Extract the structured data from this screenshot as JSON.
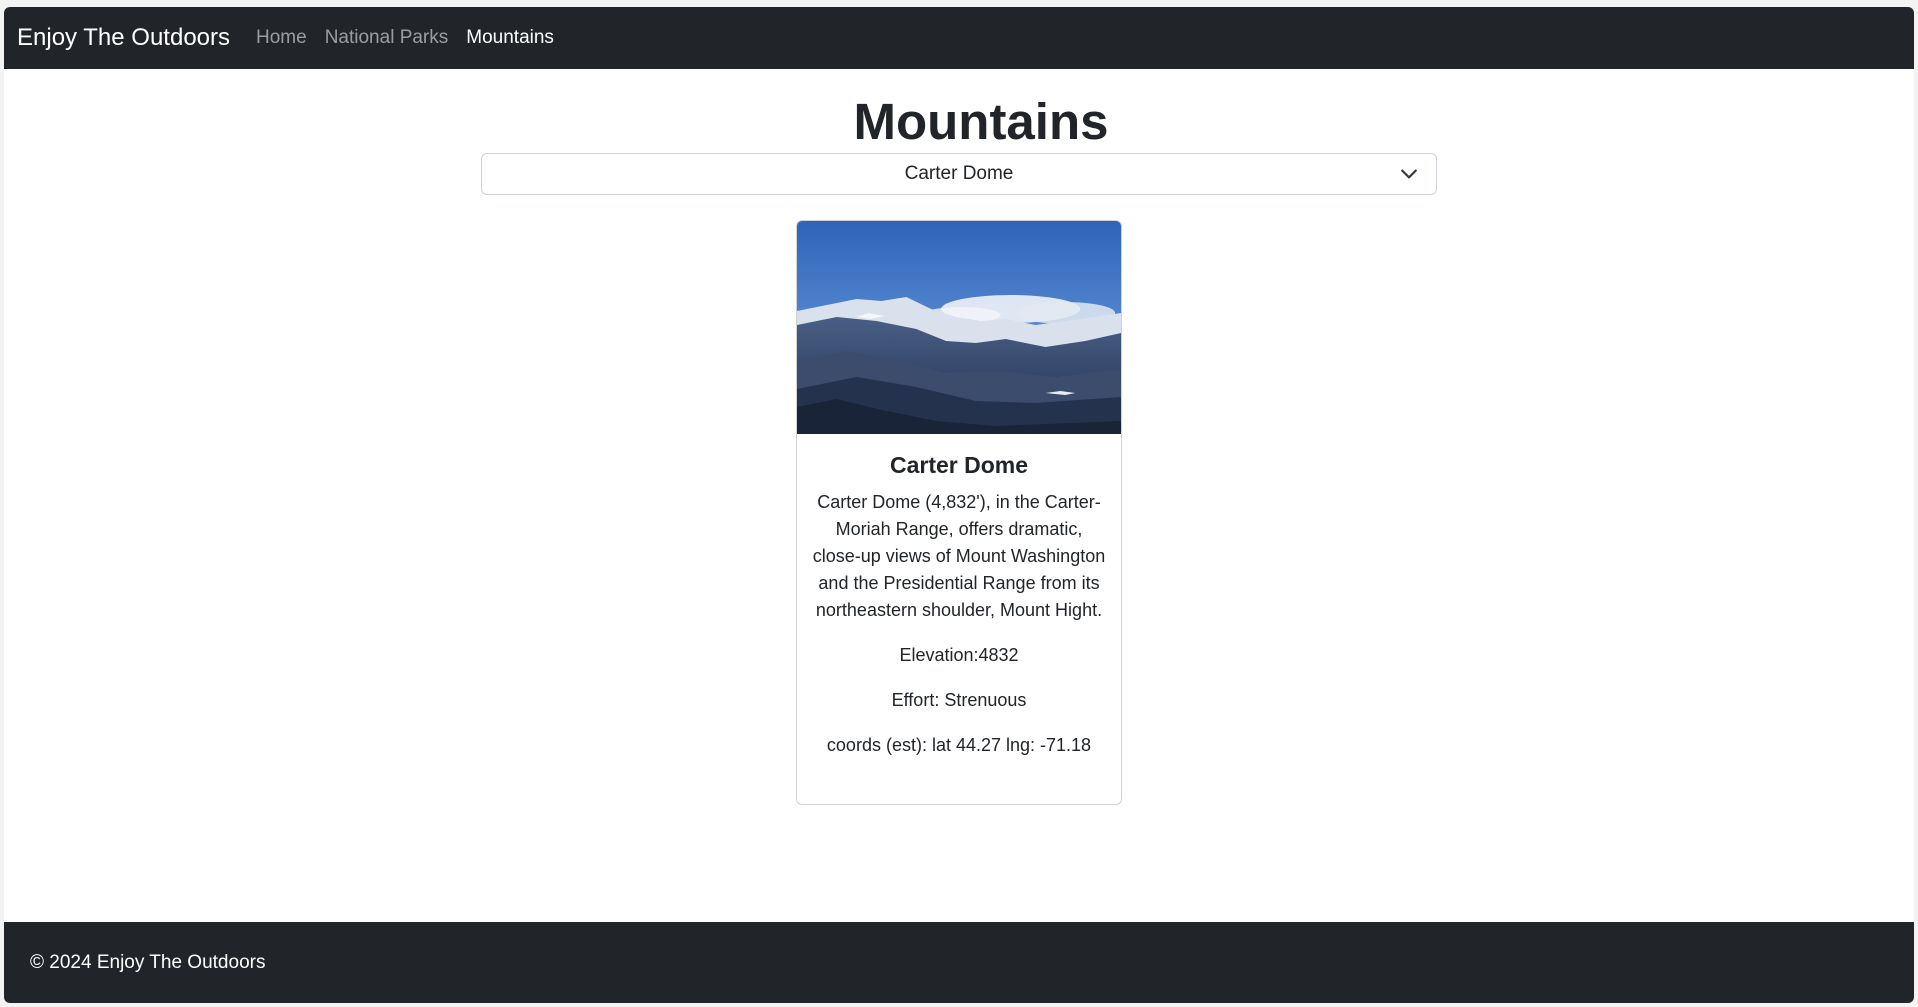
{
  "navbar": {
    "brand": "Enjoy The Outdoors",
    "links": [
      {
        "label": "Home",
        "active": false
      },
      {
        "label": "National Parks",
        "active": false
      },
      {
        "label": "Mountains",
        "active": true
      }
    ]
  },
  "main": {
    "title": "Mountains",
    "select": {
      "value": "Carter Dome",
      "icon": "chevron-down-icon"
    },
    "card": {
      "image_description_icon": "mountain-photo",
      "title": "Carter Dome",
      "description": "Carter Dome (4,832'), in the Carter-Moriah Range, offers dramatic, close-up views of Mount Washington and the Presidential Range from its northeastern shoulder, Mount Hight.",
      "elevation": "Elevation:4832",
      "effort": "Effort: Strenuous",
      "coords": "coords (est): lat 44.27 lng: -71.18"
    }
  },
  "footer": {
    "text": "© 2024 Enjoy The Outdoors"
  },
  "colors": {
    "navbar_bg": "#212529",
    "text": "#212529",
    "nav_inactive": "rgba(255,255,255,0.55)"
  }
}
